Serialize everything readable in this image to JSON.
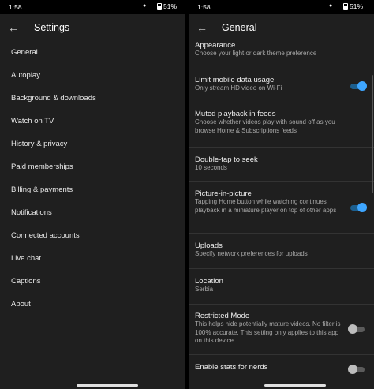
{
  "left": {
    "status": {
      "time": "1:58",
      "battery": "51%"
    },
    "title": "Settings",
    "menu": [
      "General",
      "Autoplay",
      "Background & downloads",
      "Watch on TV",
      "History & privacy",
      "Paid memberships",
      "Billing & payments",
      "Notifications",
      "Connected accounts",
      "Live chat",
      "Captions",
      "About"
    ]
  },
  "right": {
    "status": {
      "time": "1:58",
      "battery": "51%"
    },
    "title": "General",
    "settings": [
      {
        "title": "Appearance",
        "desc": "Choose your light or dark theme preference",
        "toggle": null
      },
      {
        "title": "Limit mobile data usage",
        "desc": "Only stream HD video on Wi-Fi",
        "toggle": true
      },
      {
        "title": "Muted playback in feeds",
        "desc": "Choose whether videos play with sound off as you browse Home & Subscriptions feeds",
        "toggle": null
      },
      {
        "title": "Double-tap to seek",
        "desc": "10 seconds",
        "toggle": null
      },
      {
        "title": "Picture-in-picture",
        "desc": "Tapping Home button while watching continues playback in a miniature player on top of other apps",
        "toggle": true
      },
      {
        "title": "Uploads",
        "desc": "Specify network preferences for uploads",
        "toggle": null
      },
      {
        "title": "Location",
        "desc": "Serbia",
        "toggle": null
      },
      {
        "title": "Restricted Mode",
        "desc": "This helps hide potentially mature videos. No filter is 100% accurate. This setting only applies to this app on this device.",
        "toggle": false
      },
      {
        "title": "Enable stats for nerds",
        "desc": "",
        "toggle": false
      }
    ]
  },
  "colors": {
    "background": "#1f1f1f",
    "accent": "#3ea6ff",
    "divider": "#333333"
  },
  "icons": {
    "back": "arrow-left-icon",
    "notification_dot": "dot-icon",
    "battery": "battery-icon"
  }
}
